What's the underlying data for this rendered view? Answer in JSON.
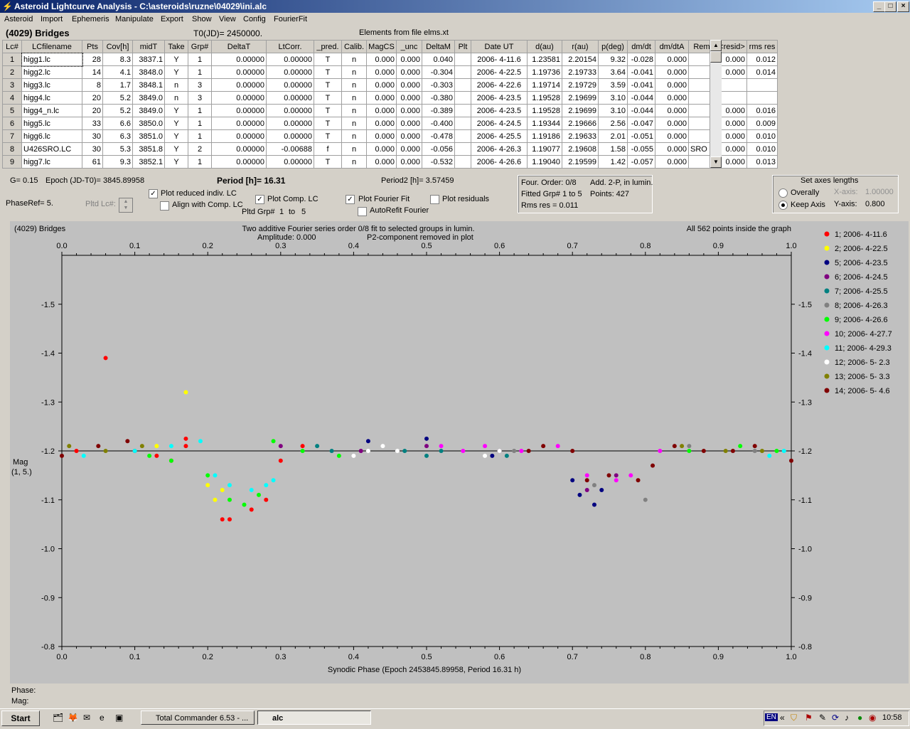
{
  "window": {
    "title": "Asteroid Lightcurve Analysis - C:\\asteroids\\ruzne\\04029\\ini.alc",
    "min": "_",
    "max": "□",
    "close": "×"
  },
  "menu": [
    "Asteroid",
    "Import",
    "Ephemeris",
    "Manipulate",
    "Export",
    "Show",
    "View",
    "Config",
    "FourierFit"
  ],
  "header": {
    "asteroid": "(4029) Bridges",
    "t0": "T0(JD)= 2450000.",
    "elements": "Elements from file elms.xt"
  },
  "table": {
    "columns": [
      "Lc#",
      "LCfilename",
      "Pts",
      "Cov[h]",
      "midT",
      "Take",
      "Grp#",
      "DeltaT",
      "LtCorr.",
      "_pred.",
      "Calib.",
      "MagCS",
      "_unc",
      "DeltaM",
      "Plt",
      "Date UT",
      "d(au)",
      "r(au)",
      "p(deg)",
      "dm/dt",
      "dm/dtA",
      "Rem.",
      "<resid>",
      "rms res"
    ],
    "rows": [
      [
        "1",
        "higg1.lc",
        "28",
        "8.3",
        "3837.1",
        "Y",
        "1",
        "0.00000",
        "0.00000",
        "T",
        "n",
        "0.000",
        "0.000",
        "0.040",
        "",
        "2006- 4-11.6",
        "1.23581",
        "2.20154",
        "9.32",
        "-0.028",
        "0.000",
        "",
        "0.000",
        "0.012"
      ],
      [
        "2",
        "higg2.lc",
        "14",
        "4.1",
        "3848.0",
        "Y",
        "1",
        "0.00000",
        "0.00000",
        "T",
        "n",
        "0.000",
        "0.000",
        "-0.304",
        "",
        "2006- 4-22.5",
        "1.19736",
        "2.19733",
        "3.64",
        "-0.041",
        "0.000",
        "",
        "0.000",
        "0.014"
      ],
      [
        "3",
        "higg3.lc",
        "8",
        "1.7",
        "3848.1",
        "n",
        "3",
        "0.00000",
        "0.00000",
        "T",
        "n",
        "0.000",
        "0.000",
        "-0.303",
        "",
        "2006- 4-22.6",
        "1.19714",
        "2.19729",
        "3.59",
        "-0.041",
        "0.000",
        "",
        "",
        ""
      ],
      [
        "4",
        "higg4.lc",
        "20",
        "5.2",
        "3849.0",
        "n",
        "3",
        "0.00000",
        "0.00000",
        "T",
        "n",
        "0.000",
        "0.000",
        "-0.380",
        "",
        "2006- 4-23.5",
        "1.19528",
        "2.19699",
        "3.10",
        "-0.044",
        "0.000",
        "",
        "",
        ""
      ],
      [
        "5",
        "higg4_n.lc",
        "20",
        "5.2",
        "3849.0",
        "Y",
        "1",
        "0.00000",
        "0.00000",
        "T",
        "n",
        "0.000",
        "0.000",
        "-0.389",
        "",
        "2006- 4-23.5",
        "1.19528",
        "2.19699",
        "3.10",
        "-0.044",
        "0.000",
        "",
        "0.000",
        "0.016"
      ],
      [
        "6",
        "higg5.lc",
        "33",
        "6.6",
        "3850.0",
        "Y",
        "1",
        "0.00000",
        "0.00000",
        "T",
        "n",
        "0.000",
        "0.000",
        "-0.400",
        "",
        "2006- 4-24.5",
        "1.19344",
        "2.19666",
        "2.56",
        "-0.047",
        "0.000",
        "",
        "0.000",
        "0.009"
      ],
      [
        "7",
        "higg6.lc",
        "30",
        "6.3",
        "3851.0",
        "Y",
        "1",
        "0.00000",
        "0.00000",
        "T",
        "n",
        "0.000",
        "0.000",
        "-0.478",
        "",
        "2006- 4-25.5",
        "1.19186",
        "2.19633",
        "2.01",
        "-0.051",
        "0.000",
        "",
        "0.000",
        "0.010"
      ],
      [
        "8",
        "U426SRO.LC",
        "30",
        "5.3",
        "3851.8",
        "Y",
        "2",
        "0.00000",
        "-0.00688",
        "f",
        "n",
        "0.000",
        "0.000",
        "-0.056",
        "",
        "2006- 4-26.3",
        "1.19077",
        "2.19608",
        "1.58",
        "-0.055",
        "0.000",
        "SRO",
        "0.000",
        "0.010"
      ],
      [
        "9",
        "higg7.lc",
        "61",
        "9.3",
        "3852.1",
        "Y",
        "1",
        "0.00000",
        "0.00000",
        "T",
        "n",
        "0.000",
        "0.000",
        "-0.532",
        "",
        "2006- 4-26.6",
        "1.19040",
        "2.19599",
        "1.42",
        "-0.057",
        "0.000",
        "",
        "0.000",
        "0.013"
      ]
    ]
  },
  "info": {
    "g": "G= 0.15",
    "epoch": "Epoch (JD-T0)= 3845.89958",
    "period": "Period [h]= 16.31",
    "period2": "Period2 [h]= 3.57459",
    "phaseref": "PhaseRef= 5.",
    "pltd_lc": "Pltd Lc#:",
    "pltd_grp": "Pltd Grp#",
    "grp_from": "1",
    "grp_to_label": "to",
    "grp_to": "5"
  },
  "checks": {
    "reduced": {
      "label": "Plot reduced indiv. LC",
      "on": true
    },
    "align": {
      "label": "Align with Comp. LC",
      "on": false
    },
    "complc": {
      "label": "Plot Comp. LC",
      "on": true
    },
    "fourier": {
      "label": "Plot Fourier Fit",
      "on": true
    },
    "autorefit": {
      "label": "AutoRefit Fourier",
      "on": false
    },
    "residuals": {
      "label": "Plot residuals",
      "on": false
    }
  },
  "fourier_box": {
    "order": "Four. Order:  0/8",
    "add": "Add. 2-P, in lumin.",
    "fitted": "Fitted Grp# 1 to 5",
    "points": "Points: 427",
    "rms": "Rms res      = 0.011"
  },
  "axes_box": {
    "title": "Set axes lengths",
    "overally": "Overally",
    "keepaxis": "Keep Axis",
    "xlabel": "X-axis:",
    "xval": "1.00000",
    "ylabel": "Y-axis:",
    "yval": "0.800"
  },
  "plot": {
    "name": "(4029) Bridges",
    "line1": "Two additive Fourier series order 0/8 fit to selected groups in lumin.",
    "amp": "Amplitude: 0.000",
    "p2": "P2-component removed in plot",
    "allpoints": "All 562 points inside the graph",
    "ylabel1": "Mag",
    "ylabel2": "(1, 5.)",
    "xlabel": "Synodic Phase (Epoch 2453845.89958, Period 16.31 h)"
  },
  "status": {
    "phase": "Phase:",
    "mag": "Mag:"
  },
  "chart_data": {
    "type": "scatter",
    "xlabel": "Synodic Phase (Epoch 2453845.89958, Period 16.31 h)",
    "ylabel": "Mag (1, 5.)",
    "xlim": [
      0.0,
      1.0
    ],
    "ylim": [
      -1.6,
      -0.8
    ],
    "y_inverted": true,
    "xticks": [
      "0.0",
      "0.1",
      "0.2",
      "0.3",
      "0.4",
      "0.5",
      "0.6",
      "0.7",
      "0.8",
      "0.9",
      "1.0"
    ],
    "yticks": [
      "-1.5",
      "-1.4",
      "-1.3",
      "-1.2",
      "-1.1",
      "-1.0",
      "-0.9",
      "-0.8"
    ],
    "fit_line": -1.2,
    "grid": false,
    "legend_position": "right",
    "series": [
      {
        "name": "1; 2006- 4-11.6",
        "color": "#ff0000",
        "points": [
          [
            0.02,
            -1.2
          ],
          [
            0.06,
            -1.39
          ],
          [
            0.1,
            -1.2
          ],
          [
            0.13,
            -1.19
          ],
          [
            0.15,
            -1.18
          ],
          [
            0.17,
            -1.21
          ],
          [
            0.22,
            -1.06
          ],
          [
            0.23,
            -1.06
          ],
          [
            0.26,
            -1.08
          ],
          [
            0.28,
            -1.1
          ],
          [
            0.3,
            -1.18
          ],
          [
            0.33,
            -1.21
          ],
          [
            0.17,
            -1.225
          ]
        ]
      },
      {
        "name": "2; 2006- 4-22.5",
        "color": "#ffff00",
        "points": [
          [
            0.17,
            -1.32
          ],
          [
            0.2,
            -1.13
          ],
          [
            0.21,
            -1.1
          ],
          [
            0.22,
            -1.12
          ],
          [
            0.13,
            -1.21
          ]
        ]
      },
      {
        "name": "5; 2006- 4-23.5",
        "color": "#000080",
        "points": [
          [
            0.42,
            -1.22
          ],
          [
            0.5,
            -1.225
          ],
          [
            0.59,
            -1.19
          ],
          [
            0.71,
            -1.11
          ],
          [
            0.73,
            -1.09
          ],
          [
            0.7,
            -1.14
          ],
          [
            0.74,
            -1.12
          ]
        ]
      },
      {
        "name": "6; 2006- 4-24.5",
        "color": "#800080",
        "points": [
          [
            0.3,
            -1.21
          ],
          [
            0.41,
            -1.2
          ],
          [
            0.5,
            -1.21
          ],
          [
            0.6,
            -1.2
          ],
          [
            0.72,
            -1.12
          ],
          [
            0.76,
            -1.15
          ]
        ]
      },
      {
        "name": "7; 2006- 4-25.5",
        "color": "#008080",
        "points": [
          [
            0.35,
            -1.21
          ],
          [
            0.37,
            -1.2
          ],
          [
            0.47,
            -1.2
          ],
          [
            0.5,
            -1.19
          ],
          [
            0.52,
            -1.2
          ],
          [
            0.61,
            -1.19
          ]
        ]
      },
      {
        "name": "8; 2006- 4-26.3",
        "color": "#808080",
        "points": [
          [
            0.6,
            -1.2
          ],
          [
            0.62,
            -1.2
          ],
          [
            0.73,
            -1.13
          ],
          [
            0.8,
            -1.1
          ],
          [
            0.86,
            -1.21
          ],
          [
            0.95,
            -1.2
          ]
        ]
      },
      {
        "name": "9; 2006- 4-26.6",
        "color": "#00ff00",
        "points": [
          [
            0.12,
            -1.19
          ],
          [
            0.15,
            -1.18
          ],
          [
            0.2,
            -1.15
          ],
          [
            0.23,
            -1.1
          ],
          [
            0.25,
            -1.09
          ],
          [
            0.27,
            -1.11
          ],
          [
            0.29,
            -1.22
          ],
          [
            0.33,
            -1.2
          ],
          [
            0.38,
            -1.19
          ],
          [
            0.86,
            -1.2
          ],
          [
            0.93,
            -1.21
          ],
          [
            0.98,
            -1.2
          ]
        ]
      },
      {
        "name": "10; 2006- 4-27.7",
        "color": "#ff00ff",
        "points": [
          [
            0.52,
            -1.21
          ],
          [
            0.55,
            -1.2
          ],
          [
            0.58,
            -1.21
          ],
          [
            0.63,
            -1.2
          ],
          [
            0.68,
            -1.21
          ],
          [
            0.72,
            -1.15
          ],
          [
            0.76,
            -1.14
          ],
          [
            0.78,
            -1.15
          ],
          [
            0.82,
            -1.2
          ]
        ]
      },
      {
        "name": "11; 2006- 4-29.3",
        "color": "#00ffff",
        "points": [
          [
            0.03,
            -1.19
          ],
          [
            0.1,
            -1.2
          ],
          [
            0.15,
            -1.21
          ],
          [
            0.19,
            -1.22
          ],
          [
            0.21,
            -1.15
          ],
          [
            0.23,
            -1.13
          ],
          [
            0.26,
            -1.12
          ],
          [
            0.28,
            -1.13
          ],
          [
            0.29,
            -1.14
          ],
          [
            0.97,
            -1.19
          ],
          [
            0.99,
            -1.2
          ]
        ]
      },
      {
        "name": "12; 2006- 5- 2.3",
        "color": "#ffffff",
        "points": [
          [
            0.4,
            -1.19
          ],
          [
            0.42,
            -1.2
          ],
          [
            0.44,
            -1.21
          ],
          [
            0.46,
            -1.2
          ],
          [
            0.58,
            -1.19
          ],
          [
            0.6,
            -1.2
          ]
        ]
      },
      {
        "name": "13; 2006- 5- 3.3",
        "color": "#808000",
        "points": [
          [
            0.01,
            -1.21
          ],
          [
            0.06,
            -1.2
          ],
          [
            0.11,
            -1.21
          ],
          [
            0.85,
            -1.21
          ],
          [
            0.91,
            -1.2
          ],
          [
            0.96,
            -1.2
          ]
        ]
      },
      {
        "name": "14; 2006- 5- 4.6",
        "color": "#800000",
        "points": [
          [
            0.0,
            -1.19
          ],
          [
            0.05,
            -1.21
          ],
          [
            0.09,
            -1.22
          ],
          [
            0.64,
            -1.2
          ],
          [
            0.66,
            -1.21
          ],
          [
            0.7,
            -1.2
          ],
          [
            0.72,
            -1.14
          ],
          [
            0.75,
            -1.15
          ],
          [
            0.79,
            -1.14
          ],
          [
            0.81,
            -1.17
          ],
          [
            0.84,
            -1.21
          ],
          [
            0.88,
            -1.2
          ],
          [
            0.92,
            -1.2
          ],
          [
            0.95,
            -1.21
          ],
          [
            1.0,
            -1.18
          ]
        ]
      }
    ]
  },
  "taskbar": {
    "start": "Start",
    "task1": "Total Commander 6.53 - ...",
    "task2": "alc",
    "lang": "EN",
    "clock": "10:58"
  }
}
